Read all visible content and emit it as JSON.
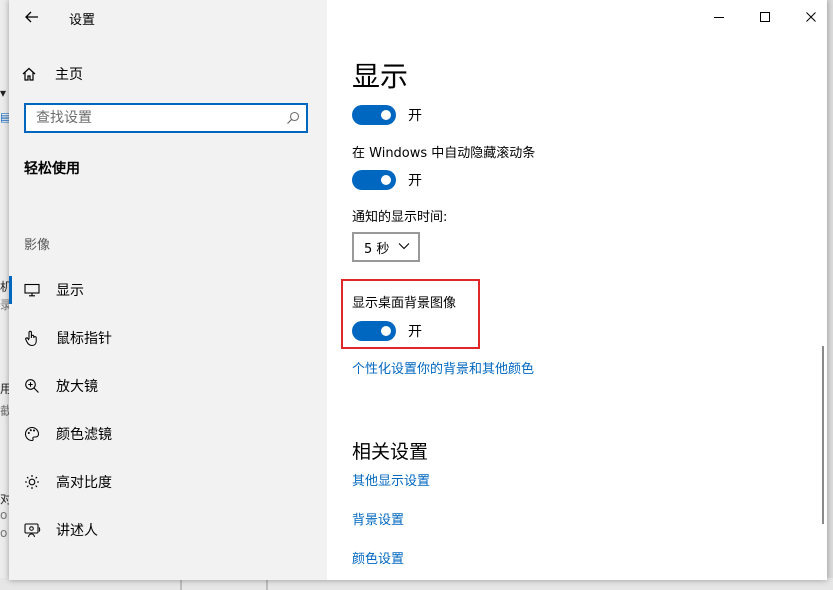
{
  "window": {
    "title": "设置",
    "controls": [
      "minimize",
      "maximize",
      "close"
    ]
  },
  "background_fragments": [
    "机",
    "录",
    "用",
    "截",
    "对",
    "o",
    "o"
  ],
  "sidebar": {
    "home_label": "主页",
    "search_placeholder": "查找设置",
    "section_title": "轻松使用",
    "group_label": "影像",
    "items": [
      {
        "label": "显示",
        "icon": "monitor-icon",
        "active": true
      },
      {
        "label": "鼠标指针",
        "icon": "pointer-icon",
        "active": false
      },
      {
        "label": "放大镜",
        "icon": "magnifier-icon",
        "active": false
      },
      {
        "label": "颜色滤镜",
        "icon": "palette-icon",
        "active": false
      },
      {
        "label": "高对比度",
        "icon": "brightness-icon",
        "active": false
      },
      {
        "label": "讲述人",
        "icon": "narrator-icon",
        "active": false
      }
    ]
  },
  "content": {
    "page_title": "显示",
    "toggle1": {
      "state": "开",
      "on": true
    },
    "scrollbar_setting": {
      "label": "在 Windows 中自动隐藏滚动条",
      "state": "开",
      "on": true
    },
    "notification": {
      "label": "通知的显示时间:",
      "value": "5 秒"
    },
    "desktop_bg": {
      "label": "显示桌面背景图像",
      "state": "开",
      "on": true
    },
    "personalize_link": "个性化设置你的背景和其他颜色",
    "related": {
      "heading": "相关设置",
      "links": [
        "其他显示设置",
        "背景设置",
        "颜色设置"
      ]
    }
  },
  "colors": {
    "accent": "#0067c0",
    "highlight": "#e02828",
    "sidebar_bg": "#f2f2f2"
  }
}
